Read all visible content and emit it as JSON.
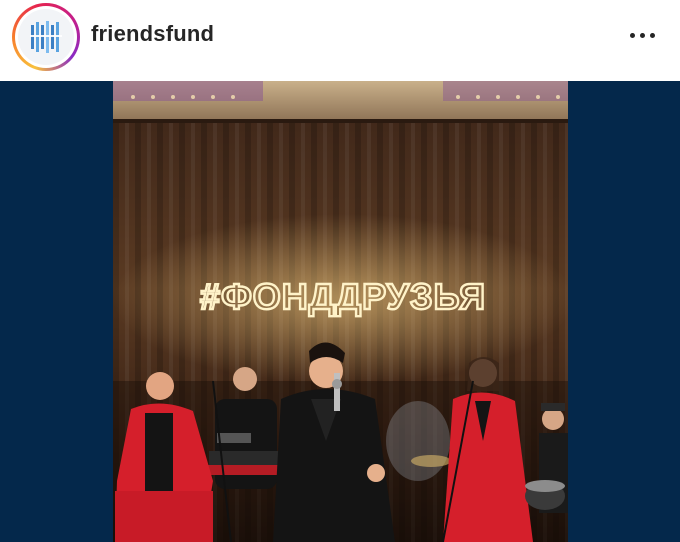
{
  "post": {
    "username": "friendsfund",
    "more_icon": "more-horizontal-icon",
    "avatar_icon": "friendsfund-logo-icon"
  },
  "media": {
    "neon_sign_text": "#ФОНДДРУЗЬЯ",
    "background_color": "#04284b",
    "neon_color": "#fff3c9"
  }
}
